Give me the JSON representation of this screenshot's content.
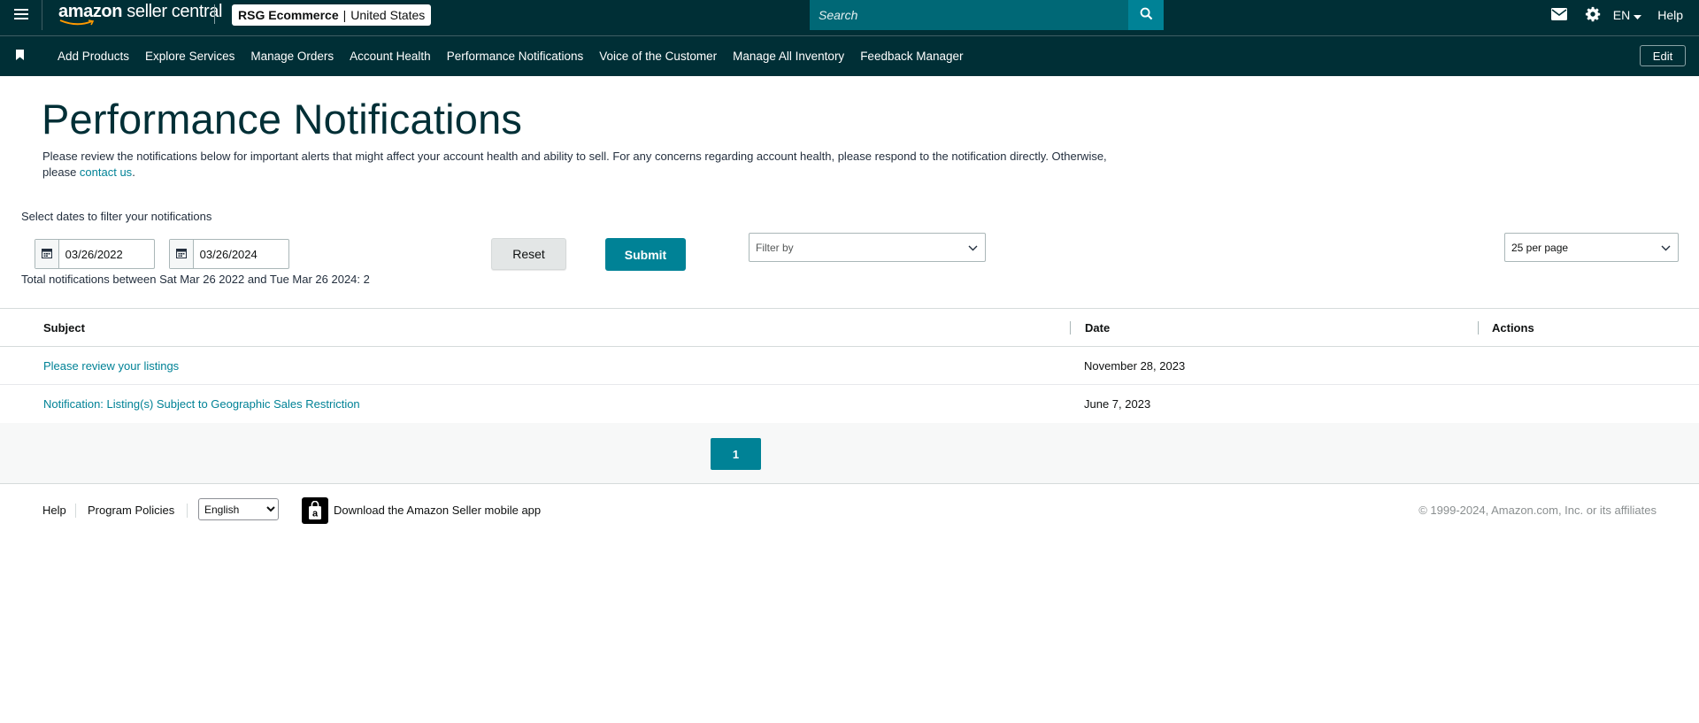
{
  "header": {
    "logo_text_bold": "amazon",
    "logo_text_light": "seller central",
    "account_name": "RSG Ecommerce",
    "account_divider": "|",
    "marketplace": "United States",
    "search_placeholder": "Search",
    "language": "EN",
    "help_label": "Help",
    "icons": [
      "menu-icon",
      "search-icon",
      "mail-icon",
      "gear-icon",
      "caret-down-icon"
    ]
  },
  "nav": {
    "items": [
      {
        "label": "Add Products"
      },
      {
        "label": "Explore Services"
      },
      {
        "label": "Manage Orders"
      },
      {
        "label": "Account Health"
      },
      {
        "label": "Performance Notifications"
      },
      {
        "label": "Voice of the Customer"
      },
      {
        "label": "Manage All Inventory"
      },
      {
        "label": "Feedback Manager"
      }
    ],
    "edit_label": "Edit"
  },
  "page": {
    "title": "Performance Notifications",
    "intro_line1": "Please review the notifications below for important alerts that might affect your account health and ability to sell. For any concerns regarding account health, please respond to the notification directly. Otherwise,",
    "intro_line2_prefix": "please ",
    "intro_link": "contact us",
    "intro_line2_suffix": "."
  },
  "filters": {
    "label": "Select dates to filter your notifications",
    "start_date": "03/26/2022",
    "end_date": "03/26/2024",
    "reset_label": "Reset",
    "submit_label": "Submit",
    "filter_by_placeholder": "Filter by",
    "per_page": "25 per page",
    "total_text": "Total notifications between Sat Mar 26 2022 and Tue Mar 26 2024: 2"
  },
  "table": {
    "headers": {
      "subject": "Subject",
      "date": "Date",
      "actions": "Actions"
    },
    "rows": [
      {
        "subject": "Please review your listings",
        "date": "November 28, 2023"
      },
      {
        "subject": "Notification: Listing(s) Subject to Geographic Sales Restriction",
        "date": "June 7, 2023"
      }
    ]
  },
  "pagination": {
    "current_page": "1"
  },
  "footer": {
    "help": "Help",
    "program_policies": "Program Policies",
    "language_selected": "English",
    "app_download": "Download the Amazon Seller mobile app",
    "copyright": "© 1999-2024, Amazon.com, Inc. or its affiliates"
  },
  "colors": {
    "header_bg": "#002f36",
    "search_bg": "#006876",
    "accent": "#008296",
    "link": "#008296"
  }
}
